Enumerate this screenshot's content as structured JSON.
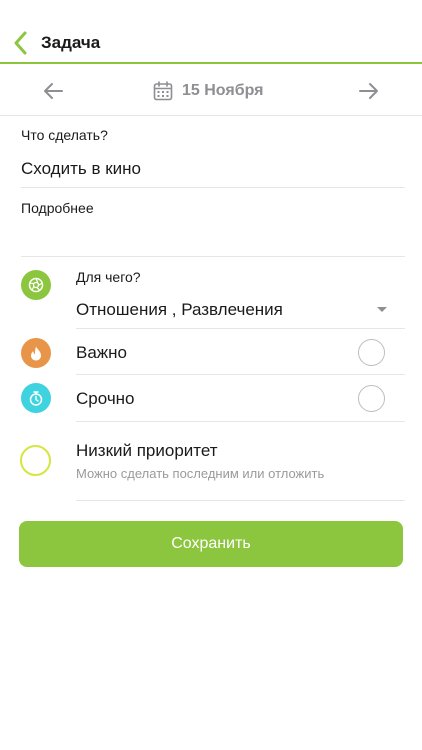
{
  "header": {
    "title": "Задача"
  },
  "date_bar": {
    "date": "15 Ноября"
  },
  "task": {
    "what_label": "Что сделать?",
    "what_value": "Сходить в кино",
    "details_label": "Подробнее",
    "details_value": ""
  },
  "purpose": {
    "label": "Для чего?",
    "value": "Отношения , Развлечения"
  },
  "important": {
    "label": "Важно"
  },
  "urgent": {
    "label": "Срочно"
  },
  "low_priority": {
    "label": "Низкий приоритет",
    "hint": "Можно сделать последним или отложить"
  },
  "save_button": {
    "label": "Сохранить"
  },
  "colors": {
    "accent": "#8cc63f",
    "purpose_icon": "#8cc63f",
    "important_icon": "#e8954a",
    "urgent_icon": "#3fd3e0",
    "low_priority_ring": "#d6e63f"
  }
}
